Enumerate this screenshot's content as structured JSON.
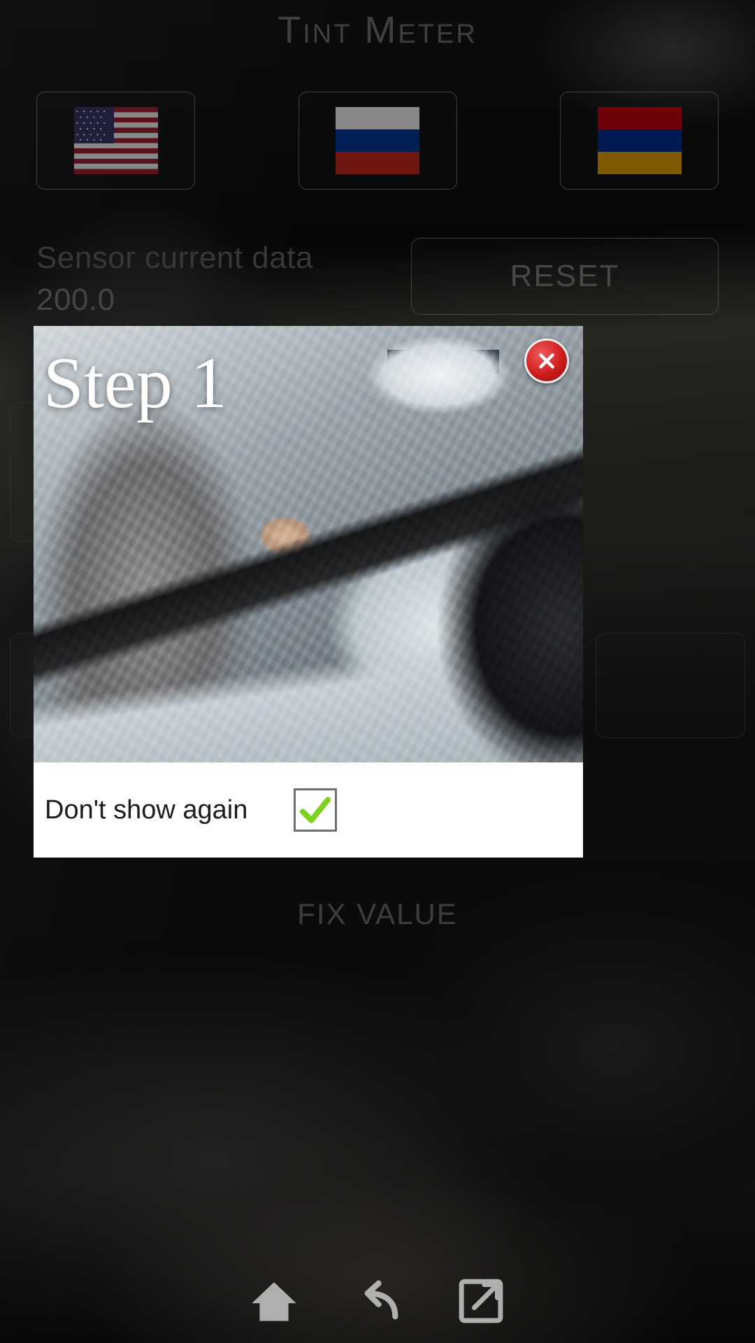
{
  "app": {
    "title": "Tint Meter"
  },
  "language_selector": {
    "options": [
      {
        "name": "United States",
        "icon": "flag-us-icon",
        "flag_colors": [
          "#b22234",
          "#ffffff",
          "#3c3b6e"
        ]
      },
      {
        "name": "Russia",
        "icon": "flag-ru-icon",
        "flag_colors": [
          "#ffffff",
          "#0039a6",
          "#d52b1e"
        ]
      },
      {
        "name": "Armenia",
        "icon": "flag-am-icon",
        "flag_colors": [
          "#d90012",
          "#0033a0",
          "#f2a800"
        ]
      }
    ]
  },
  "sensor": {
    "label": "Sensor current data",
    "value": "200.0",
    "reset_label": "RESET"
  },
  "actions": {
    "fix_value_label": "FIX VALUE"
  },
  "dialog": {
    "step_label": "Step 1",
    "close_icon": "close-circle-icon",
    "dont_show_again_label": "Don't show again",
    "dont_show_again_checked": true,
    "checkmark_color": "#7ed321"
  },
  "navbar": {
    "items": [
      {
        "name": "home-icon",
        "label": "Home"
      },
      {
        "name": "back-icon",
        "label": "Back"
      },
      {
        "name": "recent-apps-icon",
        "label": "Recent"
      }
    ]
  }
}
